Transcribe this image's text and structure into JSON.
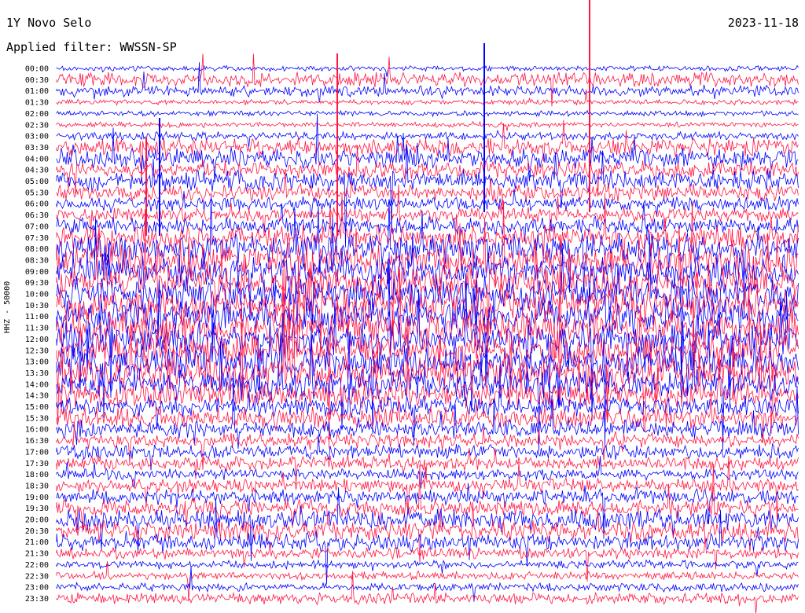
{
  "header": {
    "station": "1Y Novo Selo",
    "date": "2023-11-18",
    "filter": "Applied filter: WWSSN-SP"
  },
  "chart_data": {
    "type": "line",
    "title": "1Y Novo Selo",
    "ylabel": "HHZ - 50000",
    "rows": [
      "00:00",
      "00:30",
      "01:00",
      "01:30",
      "02:00",
      "02:30",
      "03:00",
      "03:30",
      "04:00",
      "04:30",
      "05:00",
      "05:30",
      "06:00",
      "06:30",
      "07:00",
      "07:30",
      "08:00",
      "08:30",
      "09:00",
      "09:30",
      "10:00",
      "10:30",
      "11:00",
      "11:30",
      "12:00",
      "12:30",
      "13:00",
      "13:30",
      "14:00",
      "14:30",
      "15:00",
      "15:30",
      "16:00",
      "16:30",
      "17:00",
      "17:30",
      "18:00",
      "18:30",
      "19:00",
      "19:30",
      "20:00",
      "20:30",
      "21:00",
      "21:30",
      "22:00",
      "22:30",
      "23:00",
      "23:30"
    ],
    "colors": [
      "#0000ff",
      "#ff1744"
    ],
    "activity": [
      1,
      4,
      3,
      1,
      1,
      1,
      2,
      5,
      6,
      5,
      6,
      5,
      4,
      4,
      5,
      7,
      9,
      10,
      10,
      10,
      10,
      10,
      10,
      10,
      10,
      10,
      10,
      10,
      9,
      8,
      6,
      6,
      5,
      4,
      4,
      4,
      3,
      4,
      4,
      5,
      6,
      6,
      5,
      3,
      2,
      2,
      2,
      3
    ]
  }
}
